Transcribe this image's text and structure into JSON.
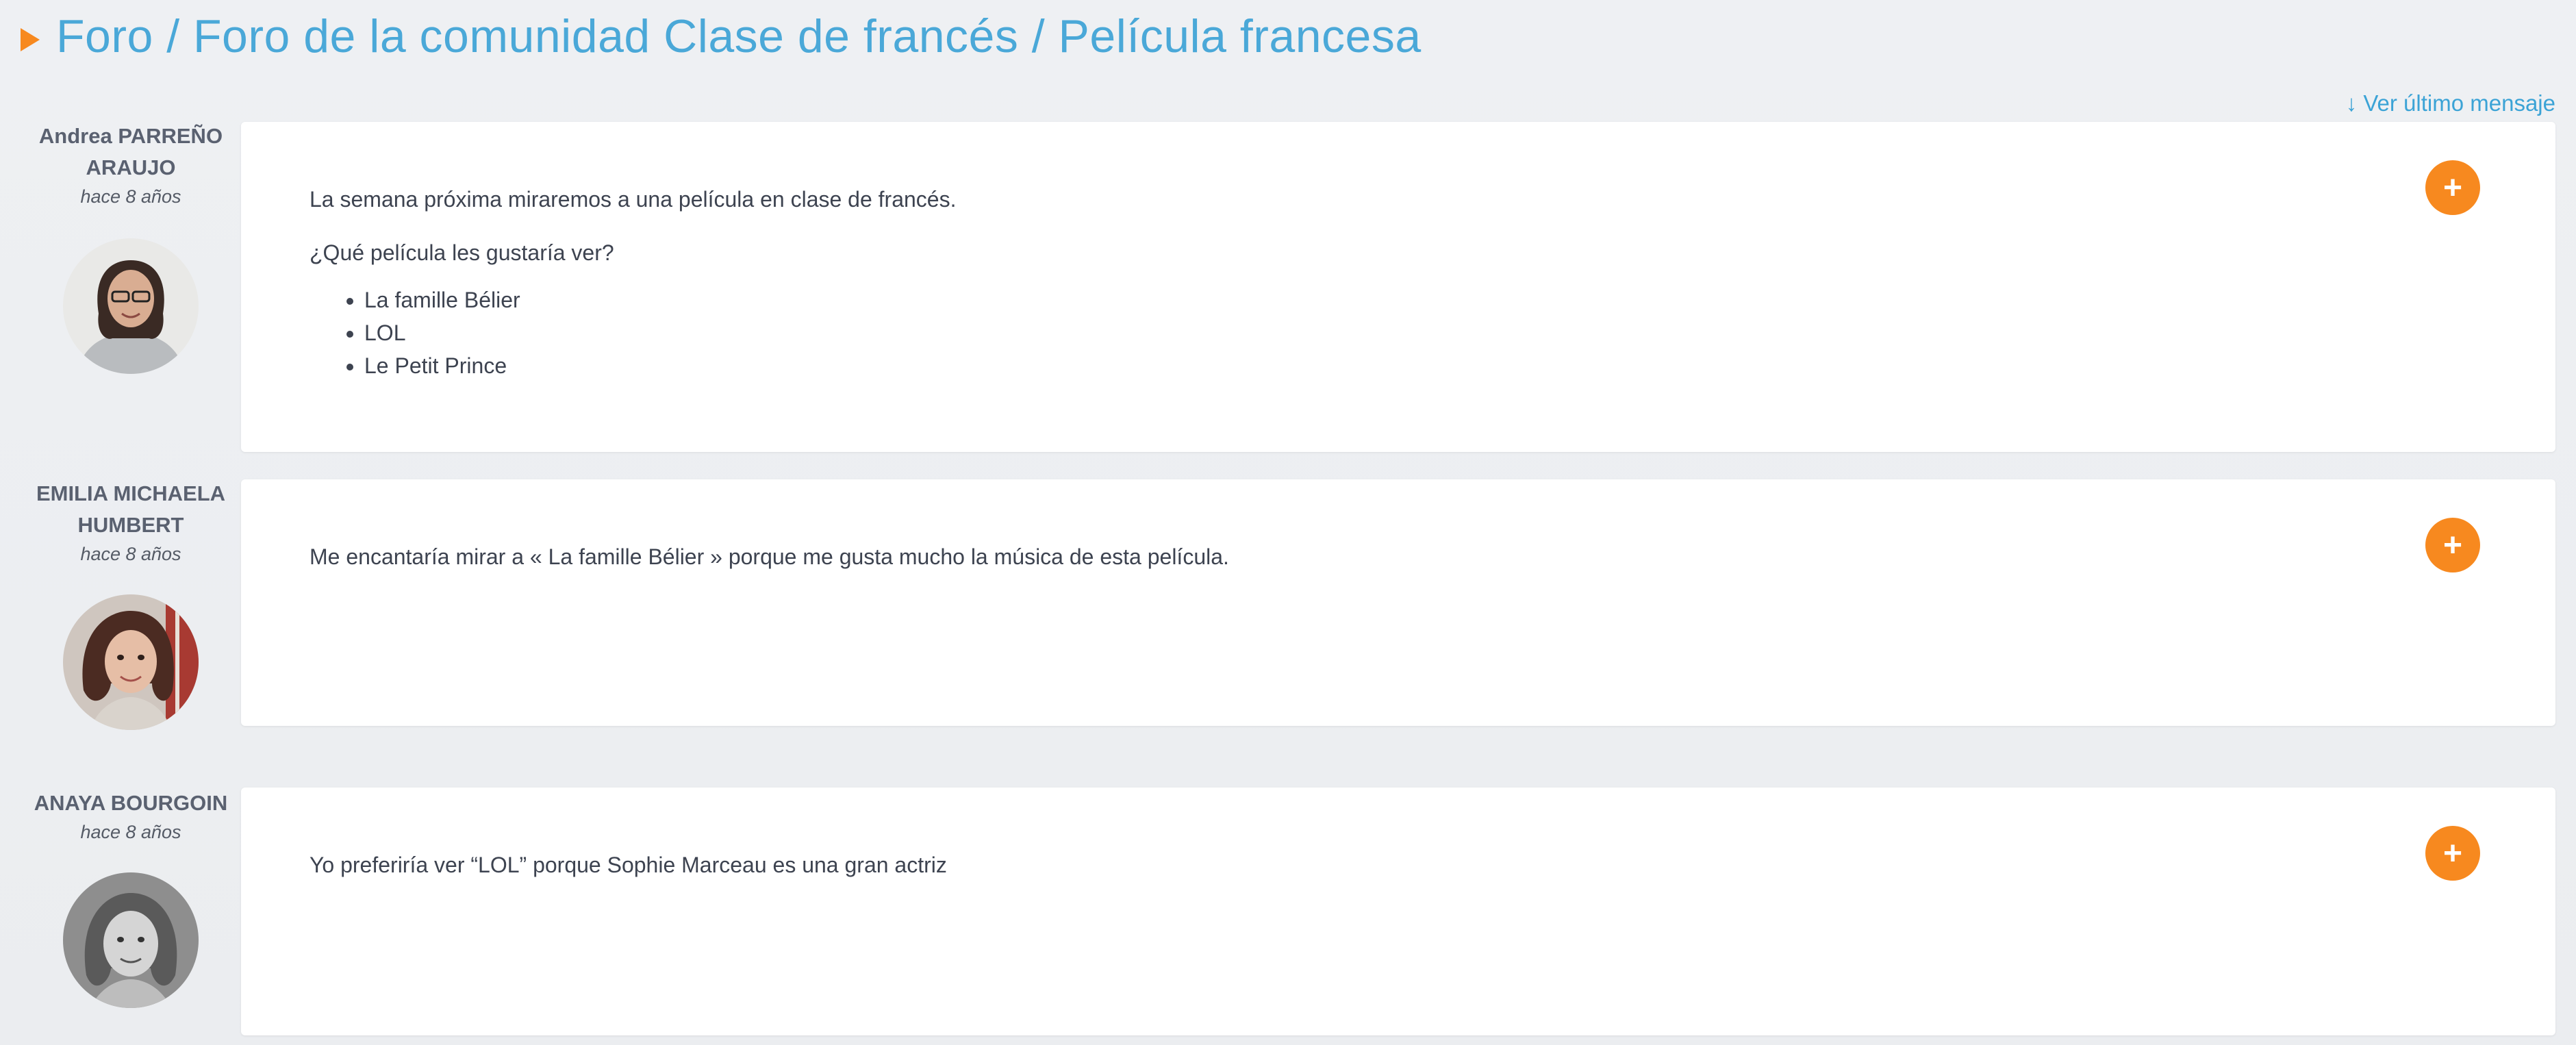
{
  "header": {
    "title": "Foro / Foro de la comunidad Clase de francés / Película francesa"
  },
  "last_message_link": "↓ Ver último mensaje",
  "posts": [
    {
      "author": "Andrea PARREÑO ARAUJO",
      "time": "hace 8 años",
      "paragraphs": [
        "La semana próxima miraremos a una película en clase de francés.",
        "¿Qué película les gustaría ver?"
      ],
      "list": [
        "La famille Bélier",
        "LOL",
        "Le Petit Prince"
      ],
      "action": "+"
    },
    {
      "author": "EMILIA MICHAELA HUMBERT",
      "time": "hace 8 años",
      "paragraphs": [
        "Me encantaría mirar a « La famille Bélier » porque me gusta mucho la música de esta película."
      ],
      "action": "+"
    },
    {
      "author": "ANAYA BOURGOIN",
      "time": "hace 8 años",
      "paragraphs": [
        "Yo preferiría ver “LOL” porque Sophie Marceau es una gran actriz"
      ],
      "action": "+"
    }
  ],
  "colors": {
    "accent": "#f7891f",
    "title": "#4aa8d8",
    "link": "#3ba3d6",
    "background": "#eef0f3"
  },
  "icons": {
    "header_marker": "triangle-right-icon",
    "post_action": "plus-icon"
  }
}
